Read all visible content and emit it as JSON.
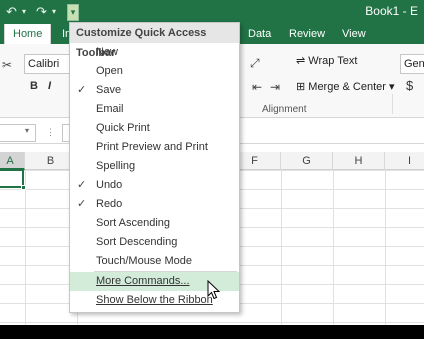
{
  "qat": {
    "undo_icon": "↶",
    "redo_icon": "↷",
    "dropdown_icon": "▾",
    "customize_icon": "▾"
  },
  "window": {
    "title": "Book1 - E"
  },
  "tabs": [
    "Home",
    "In",
    "Data",
    "Review",
    "View"
  ],
  "ribbon": {
    "font_name": "Calibri",
    "bold": "B",
    "italic": "I",
    "wrap_text": "Wrap Text",
    "merge_center": "Merge & Center",
    "alignment_group": "Alignment",
    "number_format": "Gene",
    "currency": "$"
  },
  "formula_bar": {
    "namebox_dd": "▾",
    "more": "⋮"
  },
  "columns": [
    "A",
    "B",
    "F",
    "G",
    "H",
    "I"
  ],
  "menu": {
    "title": "Customize Quick Access Toolbar",
    "items": [
      {
        "label": "New",
        "checked": false
      },
      {
        "label": "Open",
        "checked": false
      },
      {
        "label": "Save",
        "checked": true
      },
      {
        "label": "Email",
        "checked": false
      },
      {
        "label": "Quick Print",
        "checked": false
      },
      {
        "label": "Print Preview and Print",
        "checked": false
      },
      {
        "label": "Spelling",
        "checked": false
      },
      {
        "label": "Undo",
        "checked": true
      },
      {
        "label": "Redo",
        "checked": true
      },
      {
        "label": "Sort Ascending",
        "checked": false
      },
      {
        "label": "Sort Descending",
        "checked": false
      },
      {
        "label": "Touch/Mouse Mode",
        "checked": false
      }
    ],
    "more_commands": "More Commands...",
    "show_below": "Show Below the Ribbon",
    "check_mark": "✓"
  },
  "colors": {
    "excel_green": "#217346",
    "hover": "#d3ecd9"
  }
}
